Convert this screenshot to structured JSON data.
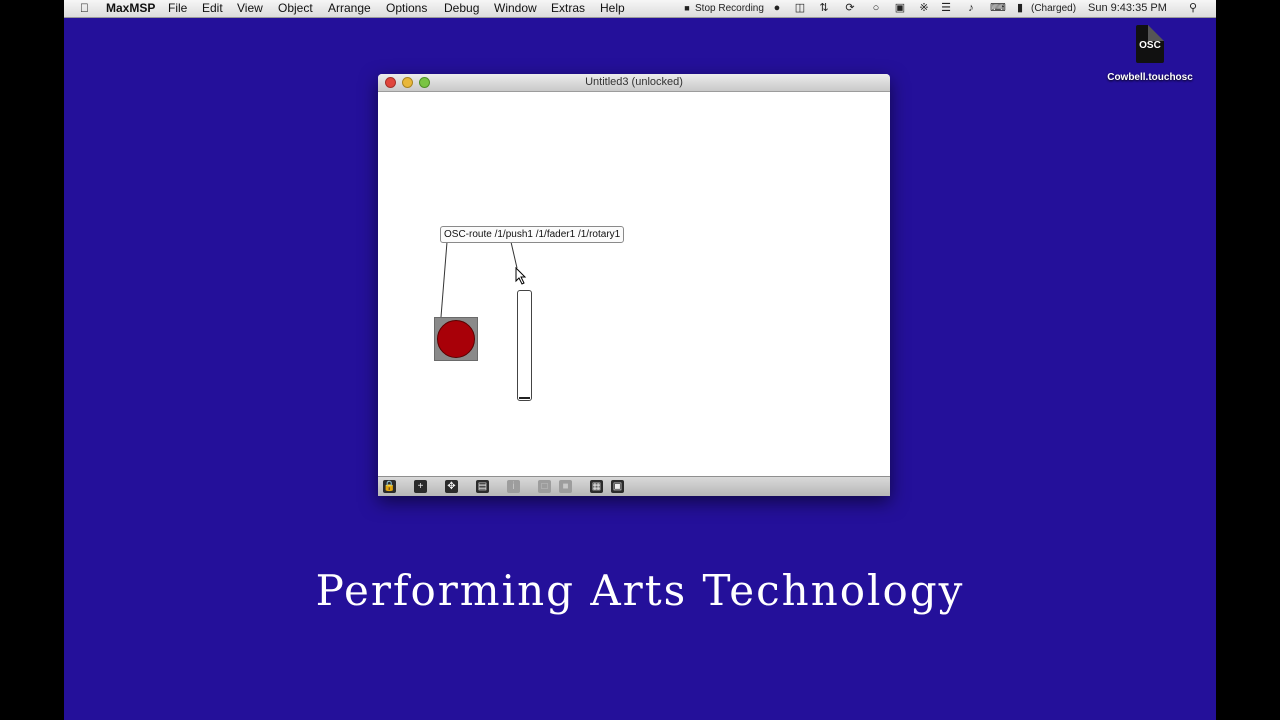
{
  "menubar": {
    "apple_icon": "apple-icon",
    "app_name": "MaxMSP",
    "items": [
      "File",
      "Edit",
      "View",
      "Object",
      "Arrange",
      "Options",
      "Debug",
      "Window",
      "Extras",
      "Help"
    ],
    "recording_label": "Stop Recording",
    "battery_text": "(Charged)",
    "clock": "Sun 9:43:35 PM"
  },
  "desktop": {
    "file_icon_text": "OSC",
    "file_name": "Cowbell.touchosc"
  },
  "window": {
    "title": "Untitled3 (unlocked)",
    "osc_route_text": "OSC-route /1/push1 /1/fader1 /1/rotary1",
    "fader_level": 0.0,
    "toolbar_icons": [
      "lock-icon",
      "new-object-icon",
      "move-icon",
      "presentation-icon",
      "inspector-icon",
      "send-back-icon",
      "bring-front-icon",
      "grid-icon",
      "snap-icon"
    ]
  },
  "caption": "Performing Arts Technology",
  "colors": {
    "desktop": "#24109a",
    "button_fill": "#a80008"
  }
}
